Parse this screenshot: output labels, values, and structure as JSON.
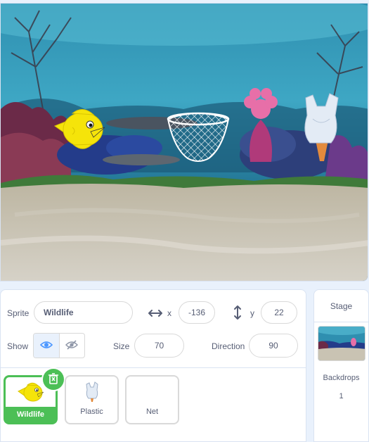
{
  "stage": {
    "scene": "underwater-coral-reef-backdrop",
    "sprites_on_stage": [
      "fish-sprite",
      "net-sprite",
      "plastic-bag-sprite"
    ]
  },
  "sprite_info": {
    "sprite_label": "Sprite",
    "sprite_name": "Wildlife",
    "x_label": "x",
    "x_value": "-136",
    "y_label": "y",
    "y_value": "22",
    "show_label": "Show",
    "size_label": "Size",
    "size_value": "70",
    "direction_label": "Direction",
    "direction_value": "90"
  },
  "sprites": [
    {
      "name": "Wildlife",
      "selected": true,
      "icon": "yellow-fish-icon"
    },
    {
      "name": "Plastic",
      "selected": false,
      "icon": "plastic-bag-icon"
    },
    {
      "name": "Net",
      "selected": false,
      "icon": "none"
    }
  ],
  "stage_panel": {
    "title": "Stage",
    "backdrops_label": "Backdrops",
    "backdrops_count": "1"
  },
  "colors": {
    "accent_green": "#4cbf56",
    "accent_blue": "#4c97ff",
    "text": "#575e75",
    "fish_yellow": "#f5e40a"
  }
}
